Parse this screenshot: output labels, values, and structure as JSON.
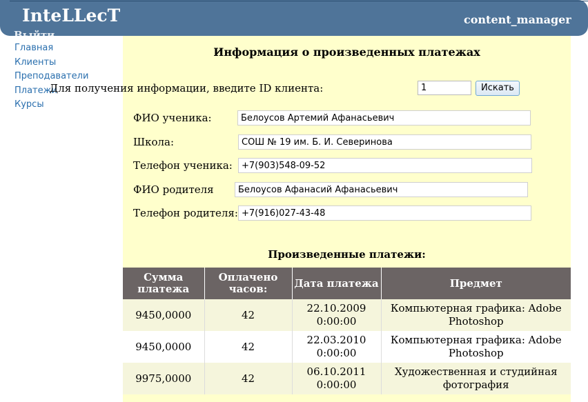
{
  "header": {
    "logo": "InteLLecT",
    "logout": "Выйти",
    "user": "content_manager"
  },
  "nav": {
    "items": [
      "Главная",
      "Клиенты",
      "Преподаватели",
      "Платежи",
      "Курсы"
    ]
  },
  "page": {
    "title": "Информация о произведенных платежах",
    "search_label": "Для получения информации, введите ID клиента:",
    "search_value": "1",
    "search_button": "Искать"
  },
  "client": {
    "student_name_label": "ФИО ученика:",
    "student_name": "Белоусов Артемий Афанасьевич",
    "school_label": "Школа:",
    "school": "СОШ № 19 им. Б. И. Северинова",
    "student_phone_label": "Телефон ученика:",
    "student_phone": "+7(903)548-09-52",
    "parent_name_label": "ФИО родителя",
    "parent_name": "Белоусов Афанасий Афанасьевич",
    "parent_phone_label": "Телефон родителя:",
    "parent_phone": "+7(916)027-43-48"
  },
  "payments": {
    "title": "Произведенные платежи:",
    "headers": [
      "Сумма платежа",
      "Оплачено часов:",
      "Дата платежа",
      "Предмет"
    ],
    "rows": [
      [
        "9450,0000",
        "42",
        "22.10.2009 0:00:00",
        "Компьютерная графика: Adobe Photoshop"
      ],
      [
        "9450,0000",
        "42",
        "22.03.2010 0:00:00",
        "Компьютерная графика: Adobe Photoshop"
      ],
      [
        "9975,0000",
        "42",
        "06.10.2011 0:00:00",
        "Художественная и студийная фотография"
      ]
    ]
  }
}
